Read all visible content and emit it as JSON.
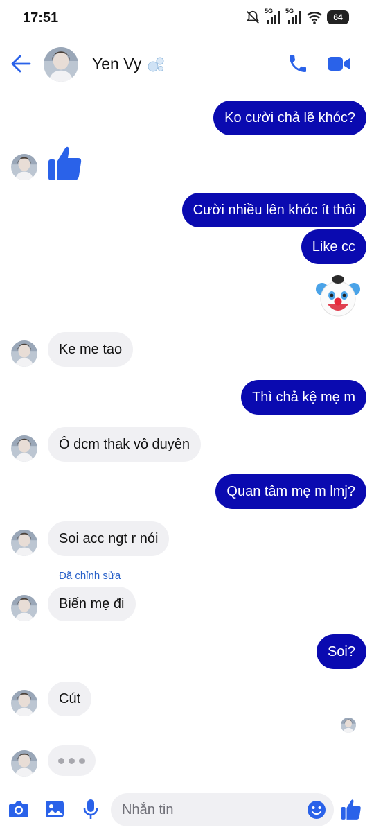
{
  "status_bar": {
    "time": "17:51",
    "network_1": "5G",
    "network_2": "5G",
    "battery": "64"
  },
  "header": {
    "contact_name": "Yen Vy",
    "back_icon": "arrow-left-icon",
    "call_icon": "phone-icon",
    "video_icon": "video-camera-icon",
    "accent_color": "#2a62e9"
  },
  "messages": [
    {
      "direction": "outgoing",
      "text": "Ko cười chả lẽ khóc?"
    },
    {
      "direction": "incoming",
      "type": "like",
      "icon": "thumbs-up-icon"
    },
    {
      "direction": "outgoing",
      "text": "Cười nhiều lên khóc ít thôi"
    },
    {
      "direction": "outgoing",
      "text": "Like cc"
    },
    {
      "direction": "outgoing",
      "type": "emoji",
      "icon": "clown-face-icon"
    },
    {
      "direction": "incoming",
      "text": "Ke me tao"
    },
    {
      "direction": "outgoing",
      "text": "Thì chả kệ mẹ m"
    },
    {
      "direction": "incoming",
      "text": "Ô dcm thak vô duyên"
    },
    {
      "direction": "outgoing",
      "text": "Quan tâm mẹ m lmj?"
    },
    {
      "direction": "incoming",
      "text": "Soi acc ngt r nói"
    },
    {
      "direction": "incoming",
      "text": "Biến mẹ đi",
      "edited_label": "Đã chỉnh sửa"
    },
    {
      "direction": "outgoing",
      "text": "Soi?"
    },
    {
      "direction": "incoming",
      "text": "Cút"
    }
  ],
  "typing_indicator": true,
  "composer": {
    "placeholder": "Nhắn tin",
    "icons": [
      "camera-icon",
      "image-icon",
      "microphone-icon",
      "emoji-icon",
      "thumbs-up-icon"
    ]
  },
  "colors": {
    "outgoing_bubble": "#0a0ab0",
    "incoming_bubble": "#f0f0f3",
    "icon_blue": "#2a62e9"
  }
}
